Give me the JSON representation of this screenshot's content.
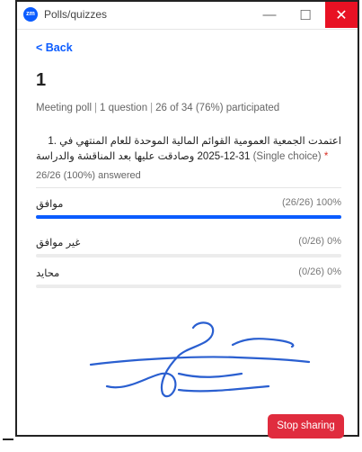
{
  "window": {
    "app_icon_text": "zm",
    "title": "Polls/quizzes",
    "minimize_glyph": "—",
    "maximize_glyph": "☐",
    "close_glyph": "✕"
  },
  "nav": {
    "back_label": "< Back"
  },
  "poll": {
    "title": "1",
    "meta_type": "Meeting poll",
    "meta_questions": "1 question",
    "meta_participation": "26 of 34 (76%) participated",
    "separator": "|"
  },
  "question": {
    "text_line1": "اعتمدت الجمعية العمومية القوائم المالية الموحدة للعام المنتهي في .1",
    "text_line2_rtl": "2025-12-31 وصادقت عليها بعد المناقشة والدراسة",
    "type_label": "(Single choice)",
    "required_marker": "*",
    "answered": "26/26 (100%) answered"
  },
  "options": [
    {
      "label": "موافق",
      "count": "(26/26) 100%",
      "percent": 100
    },
    {
      "label": "غير موافق",
      "count": "(0/26) 0%",
      "percent": 0
    },
    {
      "label": "محايد",
      "count": "(0/26) 0%",
      "percent": 0
    }
  ],
  "actions": {
    "stop_sharing_label": "Stop sharing"
  },
  "colors": {
    "accent": "#0b5cff",
    "stop": "#e02c3e",
    "close": "#e81123"
  }
}
